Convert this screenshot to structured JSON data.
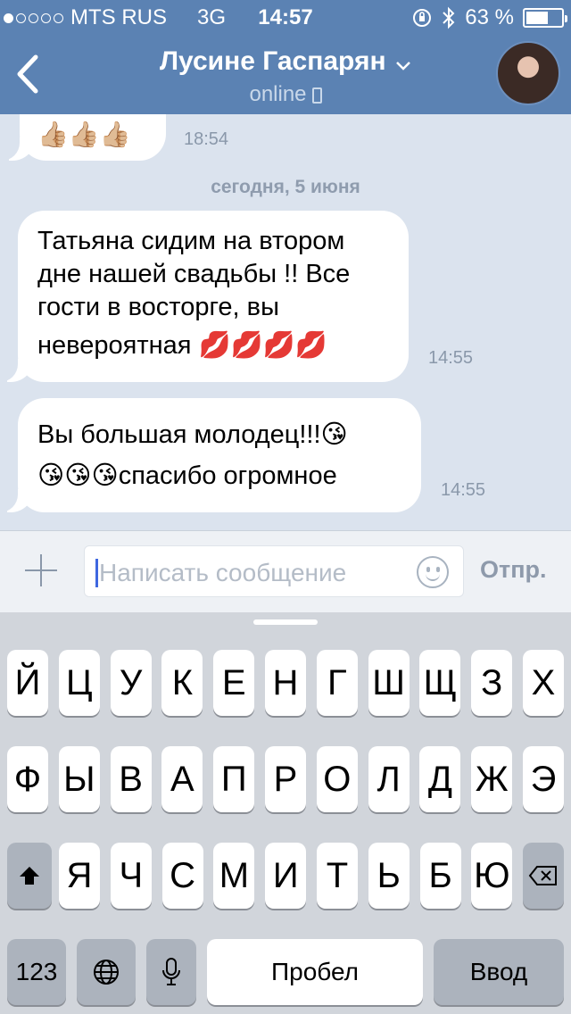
{
  "status_bar": {
    "carrier": "MTS RUS",
    "network": "3G",
    "time": "14:57",
    "battery": "63 %",
    "battery_level": 0.63,
    "signal_bars_filled": 1
  },
  "header": {
    "contact_name": "Лусине Гаспарян",
    "status": "online"
  },
  "chat": {
    "prev_message": {
      "text": "👍🏼👍🏼👍🏼",
      "time": "18:54"
    },
    "date_separator": "сегодня, 5 июня",
    "messages": [
      {
        "lines": [
          "Татьяна сидим на втором",
          "дне нашей свадьбы !! Все",
          "гости в восторге, вы",
          "невероятная 💋💋💋💋"
        ],
        "time": "14:55"
      },
      {
        "lines": [
          "Вы большая молодец!!!😘",
          "😘😘😘спасибо огромное"
        ],
        "time": "14:55"
      }
    ]
  },
  "input": {
    "placeholder": "Написать сообщение",
    "send_label": "Отпр."
  },
  "keyboard": {
    "row1": [
      "Й",
      "Ц",
      "У",
      "К",
      "Е",
      "Н",
      "Г",
      "Ш",
      "Щ",
      "З",
      "Х"
    ],
    "row2": [
      "Ф",
      "Ы",
      "В",
      "А",
      "П",
      "Р",
      "О",
      "Л",
      "Д",
      "Ж",
      "Э"
    ],
    "row3": [
      "Я",
      "Ч",
      "С",
      "М",
      "И",
      "Т",
      "Ь",
      "Б",
      "Ю"
    ],
    "numbers_label": "123",
    "space_label": "Пробел",
    "return_label": "Ввод"
  },
  "colors": {
    "header": "#5b82b3",
    "chat_bg": "#dbe3ee",
    "caret": "#3e67e0",
    "keyboard_bg": "#d1d5db"
  }
}
